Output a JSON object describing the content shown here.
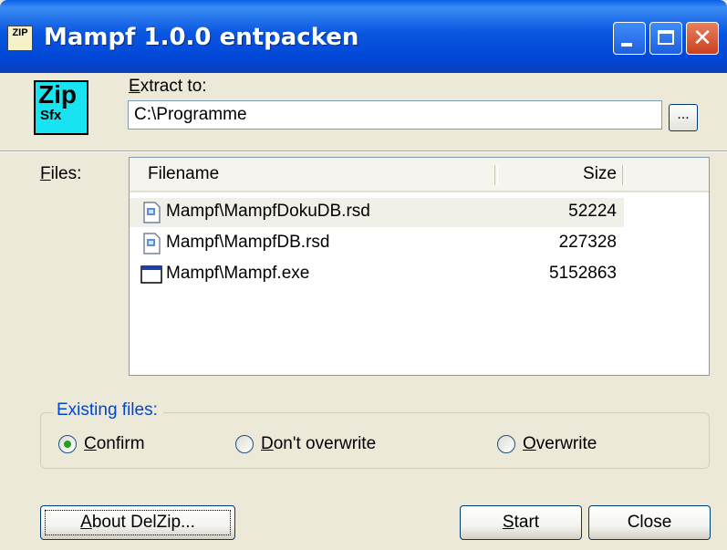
{
  "window": {
    "title": "Mampf 1.0.0 entpacken",
    "icon_text": "ZIP",
    "controls": [
      "minimize",
      "maximize",
      "close"
    ],
    "close_glyph": "✕"
  },
  "logo": {
    "line1": "Zip",
    "line2": "Sfx"
  },
  "extract": {
    "label_accel": "E",
    "label_rest": "xtract to:",
    "path_value": "C:\\Programme",
    "browse_label": "..."
  },
  "files": {
    "label_accel": "F",
    "label_rest": "iles:",
    "columns": [
      "Filename",
      "Size"
    ],
    "rows": [
      {
        "name": "Mampf\\MampfDokuDB.rsd",
        "size": "52224",
        "icon": "file-icon",
        "selected": true
      },
      {
        "name": "Mampf\\MampfDB.rsd",
        "size": "227328",
        "icon": "file-icon",
        "selected": false
      },
      {
        "name": "Mampf\\Mampf.exe",
        "size": "5152863",
        "icon": "exe-window-icon",
        "selected": false
      }
    ]
  },
  "existing_files": {
    "title": "Existing files:",
    "options": [
      {
        "accel": "C",
        "rest": "onfirm",
        "checked": true
      },
      {
        "accel": "D",
        "rest": "on't overwrite",
        "checked": false
      },
      {
        "accel": "O",
        "rest": "verwrite",
        "checked": false
      }
    ]
  },
  "buttons": {
    "about": {
      "accel": "A",
      "rest": "bout DelZip..."
    },
    "start": {
      "accel": "S",
      "rest": "tart"
    },
    "close": {
      "label": "Close"
    }
  },
  "colors": {
    "titlebar": "#0a5fe6",
    "dialog_bg": "#ece9d8",
    "group_title": "#0046d5",
    "radio_dot": "#21a121",
    "logo_bg": "#17e4f0"
  }
}
